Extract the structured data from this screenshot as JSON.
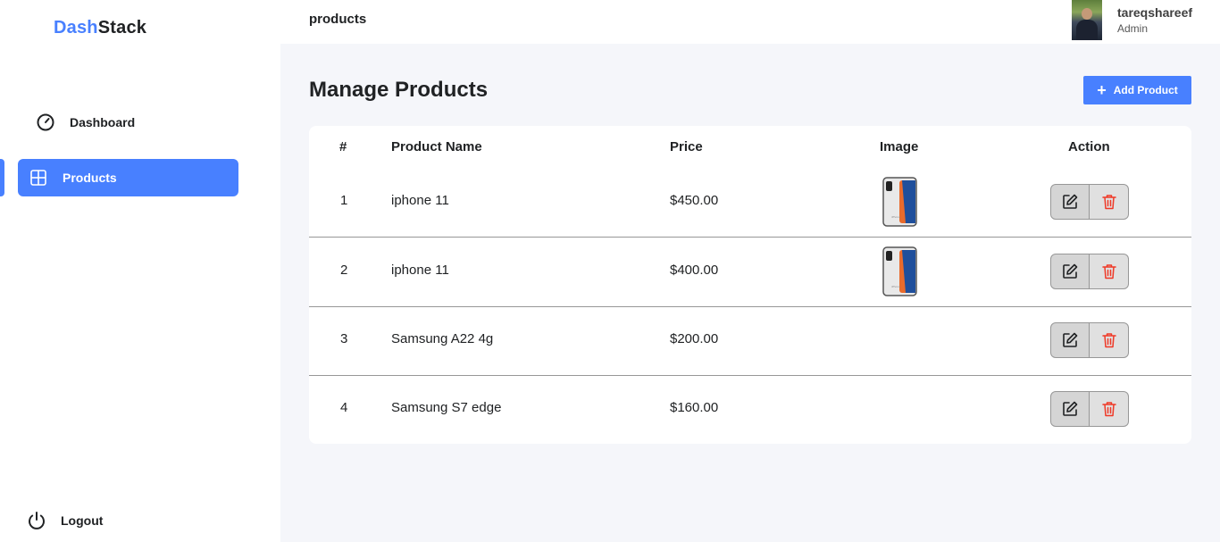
{
  "brand": {
    "part1": "Dash",
    "part2": "Stack"
  },
  "sidebar": {
    "items": [
      {
        "label": "Dashboard",
        "icon": "speedometer-icon",
        "active": false
      },
      {
        "label": "Products",
        "icon": "grid-icon",
        "active": true
      }
    ],
    "logout_label": "Logout"
  },
  "header": {
    "title": "products"
  },
  "user": {
    "name": "tareqshareef",
    "role": "Admin"
  },
  "page": {
    "title": "Manage Products",
    "add_button": "Add Product"
  },
  "table": {
    "columns": [
      "#",
      "Product Name",
      "Price",
      "Image",
      "Action"
    ],
    "rows": [
      {
        "id": "1",
        "name": "iphone 11",
        "price": "$450.00",
        "has_image": true
      },
      {
        "id": "2",
        "name": "iphone 11",
        "price": "$400.00",
        "has_image": true
      },
      {
        "id": "3",
        "name": "Samsung A22 4g",
        "price": "$200.00",
        "has_image": false
      },
      {
        "id": "4",
        "name": "Samsung S7 edge",
        "price": "$160.00",
        "has_image": false
      }
    ]
  },
  "colors": {
    "accent": "#4880ff",
    "delete": "#ef3826",
    "background": "#f5f6fa"
  }
}
